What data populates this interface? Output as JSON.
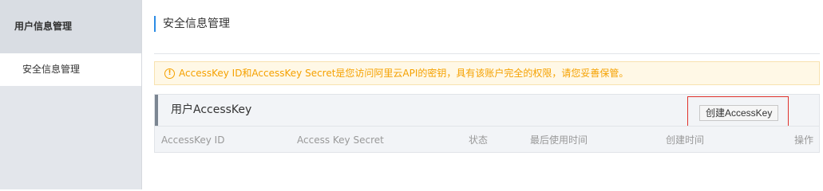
{
  "sidebar": {
    "header": "用户信息管理",
    "items": [
      {
        "label": "安全信息管理"
      }
    ]
  },
  "main": {
    "title": "安全信息管理",
    "alert": {
      "icon": "warning-circle-icon",
      "text": "AccessKey ID和AccessKey Secret是您访问阿里云API的密钥，具有该账户完全的权限，请您妥善保管。"
    },
    "panel": {
      "title": "用户AccessKey",
      "create_button": "创建AccessKey",
      "columns": [
        "AccessKey ID",
        "Access Key Secret",
        "状态",
        "最后使用时间",
        "创建时间",
        "操作"
      ]
    }
  },
  "colors": {
    "accent": "#2b8ce5",
    "warning": "#f5a100",
    "highlight_box": "#e0322c"
  }
}
